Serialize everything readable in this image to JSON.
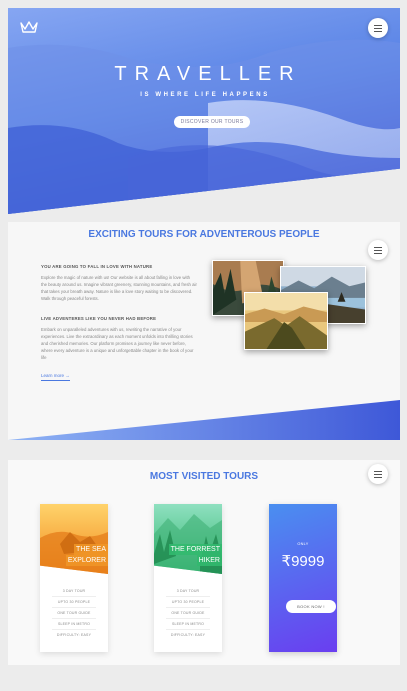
{
  "hero": {
    "title": "TRAVELLER",
    "subtitle": "IS WHERE LIFE HAPPENS",
    "cta": "DISCOVER OUR TOURS"
  },
  "about": {
    "title": "EXCITING TOURS FOR ADVENTEROUS PEOPLE",
    "heading1": "YOU ARE GOING TO FALL IN LOVE WITH NATURE",
    "para1": "Explore the magic of nature with us! Our website is all about falling in love with the beauty around us. Imagine vibrant greenery, stunning mountains, and fresh air that takes your breath away. Nature is like a love story waiting to be discovered. Walk through peaceful forests.",
    "heading2": "LIVE ADVENTERES LIKE YOU NEVER HAD BEFORE",
    "para2": "Embark on unparalleled adventures with us, rewriting the narrative of your experiences. Live the extraordinary as each moment unfolds into thrilling stories and cherished memories. Our platform promises a journey like never before, where every adventure is a unique and unforgettable chapter in the book of your life",
    "learn_more": "Learn more →"
  },
  "tours": {
    "title": "MOST VISITED TOURS",
    "cards": [
      {
        "label_line1": "THE SEA",
        "label_line2": "EXPLORER",
        "features": [
          "3 DAY TOUR",
          "UPTO 30 PEOPLE",
          "ONE TOUR GUIDE",
          "SLEEP IN METRO",
          "DIFFICULTY: EASY"
        ]
      },
      {
        "label_line1": "THE FORREST",
        "label_line2": "HIKER",
        "features": [
          "3 DAY TOUR",
          "UPTO 30 PEOPLE",
          "ONE TOUR GUIDE",
          "SLEEP IN METRO",
          "DIFFICULTY: EASY"
        ]
      }
    ],
    "price_card": {
      "only": "ONLY",
      "price": "₹9999",
      "cta": "BOOK NOW !"
    }
  },
  "colors": {
    "accent": "#4a78e0",
    "hero_top": "#7d9af0",
    "hero_bottom": "#3b5fd8",
    "card1_overlay": "#f29a2a",
    "card2_overlay": "#3cbf78",
    "price_gradient_start": "#4a8ff0",
    "price_gradient_end": "#6a3ef0"
  },
  "icons": {
    "logo": "crown-icon",
    "menu": "hamburger-icon"
  }
}
